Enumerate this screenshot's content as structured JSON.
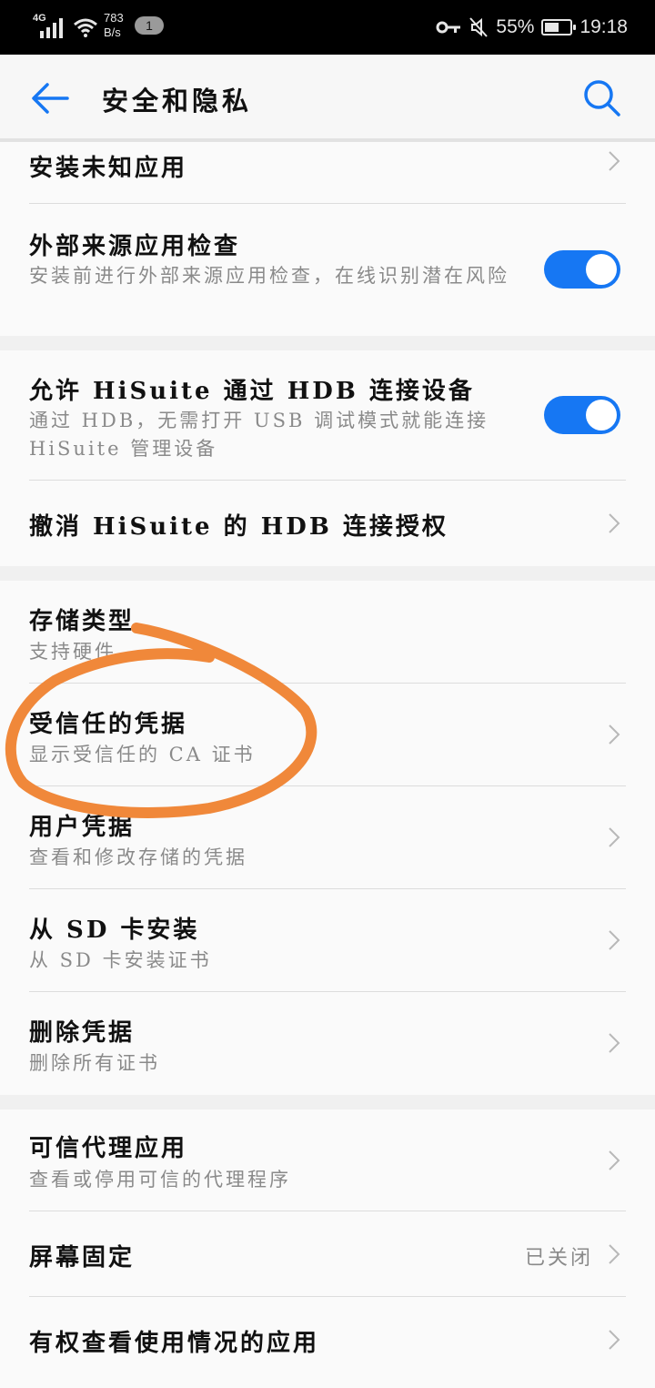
{
  "status_bar": {
    "network": "4G",
    "speed_value": "783",
    "speed_unit": "B/s",
    "notification_count": "1",
    "battery_percent": "55%",
    "battery_level": 0.55,
    "time": "19:18",
    "icons": [
      "signal-icon",
      "wifi-icon",
      "key-icon",
      "mute-icon",
      "battery-icon"
    ]
  },
  "header": {
    "title": "安全和隐私",
    "back_icon": "arrow-left-icon",
    "search_icon": "search-icon",
    "accent_color": "#1677f3"
  },
  "sections": [
    {
      "items": [
        {
          "title": "安装未知应用",
          "control": "chevron"
        },
        {
          "title": "外部来源应用检查",
          "subtitle": "安装前进行外部来源应用检查，在线识别潜在风险",
          "control": "toggle",
          "on": true
        }
      ]
    },
    {
      "items": [
        {
          "title": "允许 HiSuite 通过 HDB 连接设备",
          "subtitle": "通过 HDB，无需打开 USB 调试模式就能连接 HiSuite 管理设备",
          "control": "toggle",
          "on": true
        },
        {
          "title": "撤消 HiSuite 的 HDB 连接授权",
          "control": "chevron"
        }
      ]
    },
    {
      "items": [
        {
          "title": "存储类型",
          "subtitle": "支持硬件",
          "control": "none"
        },
        {
          "title": "受信任的凭据",
          "subtitle": "显示受信任的 CA 证书",
          "control": "chevron"
        },
        {
          "title": "用户凭据",
          "subtitle": "查看和修改存储的凭据",
          "control": "chevron"
        },
        {
          "title": "从 SD 卡安装",
          "subtitle": "从 SD 卡安装证书",
          "control": "chevron"
        },
        {
          "title": "删除凭据",
          "subtitle": "删除所有证书",
          "control": "chevron"
        }
      ]
    },
    {
      "items": [
        {
          "title": "可信代理应用",
          "subtitle": "查看或停用可信的代理程序",
          "control": "chevron"
        },
        {
          "title": "屏幕固定",
          "value": "已关闭",
          "control": "chevron"
        },
        {
          "title": "有权查看使用情况的应用",
          "control": "chevron"
        }
      ]
    }
  ],
  "annotation": {
    "color": "#f0883a",
    "circled_item": "受信任的凭据"
  }
}
